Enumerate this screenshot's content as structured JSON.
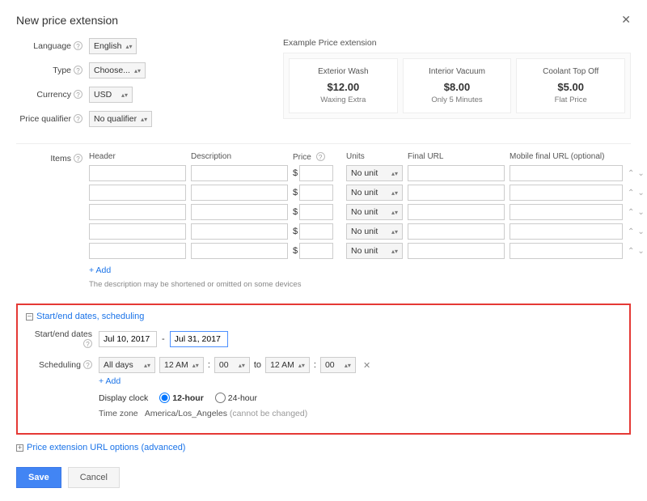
{
  "title": "New price extension",
  "labels": {
    "language": "Language",
    "type": "Type",
    "currency": "Currency",
    "priceQualifier": "Price qualifier",
    "items": "Items",
    "header": "Header",
    "description": "Description",
    "price": "Price",
    "units": "Units",
    "finalUrl": "Final URL",
    "mobileFinalUrl": "Mobile final URL (optional)",
    "add": "+ Add",
    "hint": "The description may be shortened or omitted on some devices",
    "schedToggle": "Start/end dates, scheduling",
    "startEnd": "Start/end dates",
    "scheduling": "Scheduling",
    "to": "to",
    "dash": "-",
    "displayClock": "Display clock",
    "hour12": "12-hour",
    "hour24": "24-hour",
    "timezoneLabel": "Time zone",
    "timezoneValue": "America/Los_Angeles",
    "timezoneNote": "(cannot be changed)",
    "advanced": "Price extension URL options (advanced)",
    "dollar": "$"
  },
  "selects": {
    "language": "English",
    "type": "Choose...",
    "currency": "USD",
    "priceQualifier": "No qualifier",
    "noUnit": "No unit",
    "allDays": "All days",
    "am": "12 AM",
    "zero": "00"
  },
  "example": {
    "title": "Example Price extension",
    "cards": [
      {
        "title": "Exterior Wash",
        "price": "$12.00",
        "desc": "Waxing Extra"
      },
      {
        "title": "Interior Vacuum",
        "price": "$8.00",
        "desc": "Only 5 Minutes"
      },
      {
        "title": "Coolant Top Off",
        "price": "$5.00",
        "desc": "Flat Price"
      }
    ]
  },
  "dates": {
    "start": "Jul 10, 2017",
    "end": "Jul 31, 2017"
  },
  "buttons": {
    "save": "Save",
    "cancel": "Cancel"
  }
}
